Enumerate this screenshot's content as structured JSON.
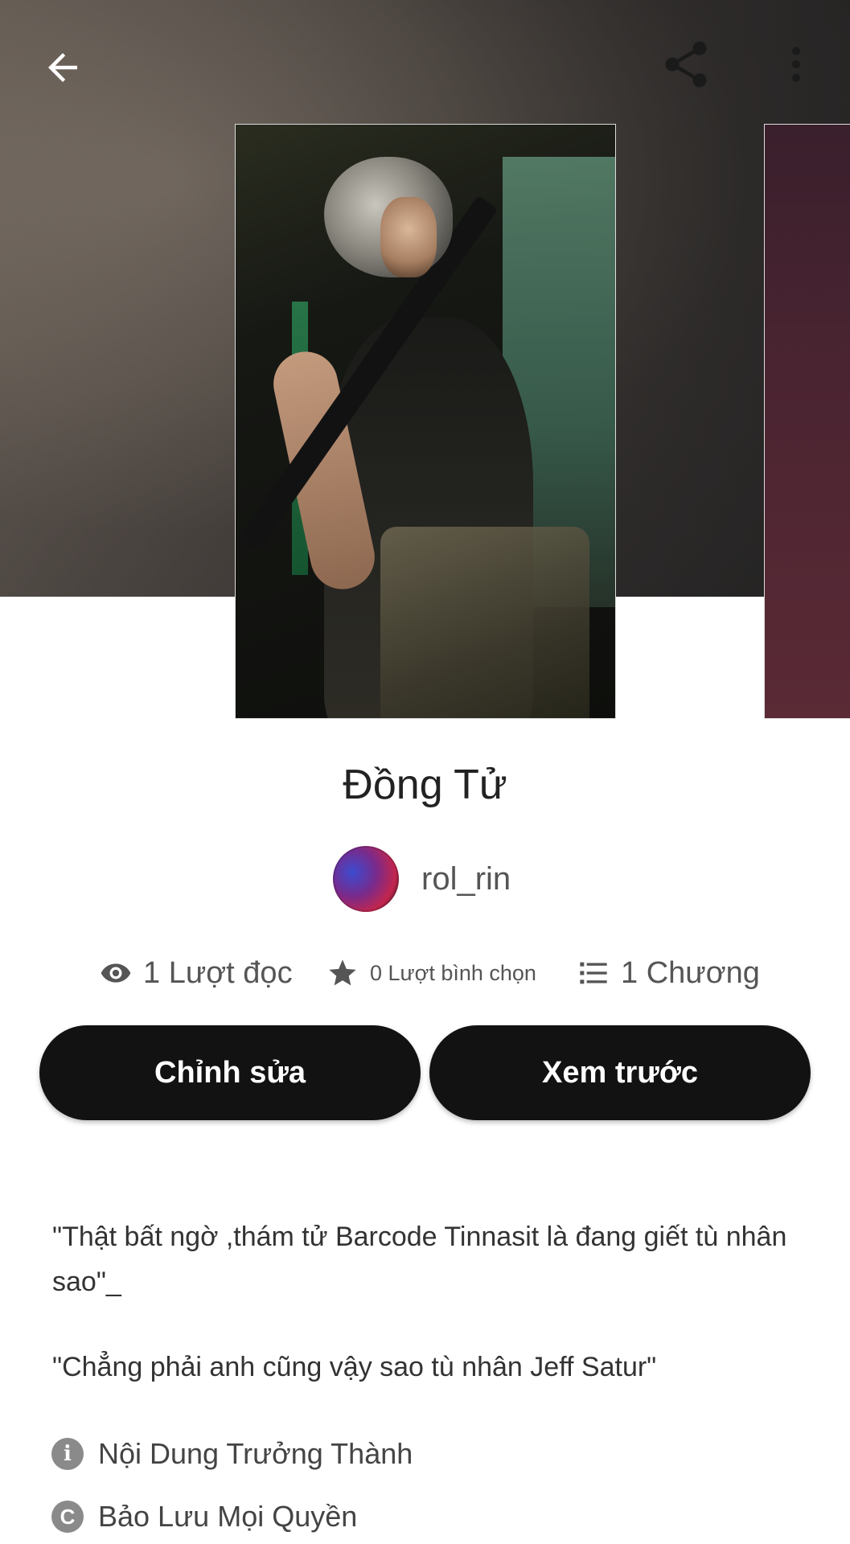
{
  "header": {
    "back_icon": "arrow-left-icon",
    "share_icon": "share-icon",
    "more_icon": "more-vertical-icon"
  },
  "story": {
    "title": "Đồng Tử",
    "author": "rol_rin"
  },
  "stats": {
    "reads": "1 Lượt đọc",
    "votes": "0 Lượt bình chọn",
    "chapters": "1 Chương"
  },
  "actions": {
    "edit_label": "Chỉnh sửa",
    "preview_label": "Xem trước"
  },
  "description": {
    "line1": "\"Thật bất ngờ ,thám tử Barcode Tinnasit là đang  giết tù nhân sao\"_",
    "line2": "\"Chẳng phải anh cũng vậy sao tù nhân Jeff Satur\""
  },
  "tags": {
    "mature": "Nội Dung Trưởng Thành",
    "copyright": "Bảo Lưu Mọi Quyền",
    "copyright_glyph": "C",
    "info_glyph": "i"
  },
  "colors": {
    "button_bg": "#121212",
    "button_text": "#ffffff",
    "icon_gray": "#8a8a8a"
  }
}
